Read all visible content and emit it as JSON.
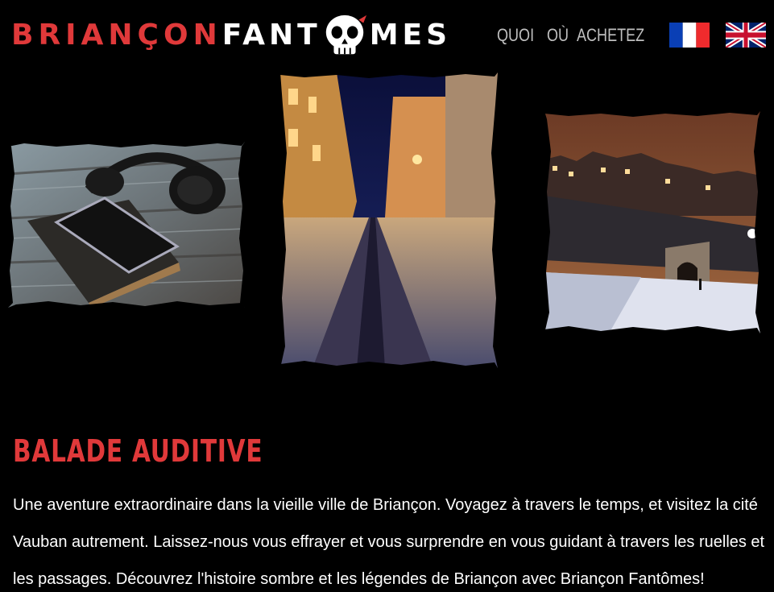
{
  "header": {
    "logo_part1": "BRIANÇON",
    "logo_part2": "FANT",
    "logo_part3": "MES",
    "nav": {
      "quoi": "QUOI",
      "ou": "OÙ",
      "achetez": "ACHETEZ"
    },
    "flags": [
      "french-flag-icon",
      "uk-flag-icon"
    ]
  },
  "main": {
    "title": "BALADE AUDITIVE",
    "description": "Une aventure extraordinaire dans la vieille ville de Briançon. Voyagez à travers le temps, et visitez la cité Vauban autrement. Laissez-nous vous effrayer et vous surprendre en vous guidant à travers les ruelles et les passages. Découvrez l'histoire sombre et les légendes de Briançon avec Briançon Fantômes!"
  },
  "colors": {
    "background": "#000000",
    "accent_red": "#e0393a",
    "nav_grey": "#bfbfbf",
    "text_white": "#ffffff"
  }
}
